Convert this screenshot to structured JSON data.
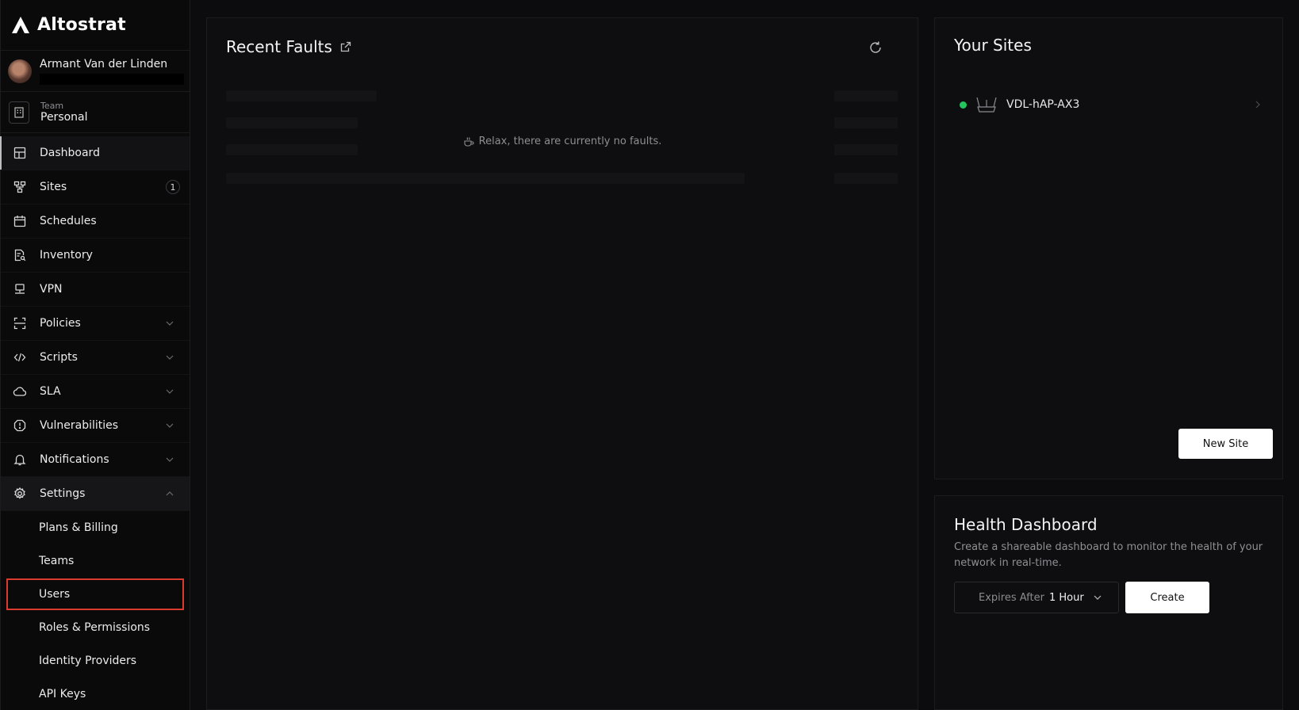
{
  "brand": {
    "name": "Altostrat"
  },
  "user": {
    "name": "Armant Van der Linden"
  },
  "team": {
    "label": "Team",
    "name": "Personal"
  },
  "nav": {
    "dashboard": "Dashboard",
    "sites": "Sites",
    "sites_badge": "1",
    "schedules": "Schedules",
    "inventory": "Inventory",
    "vpn": "VPN",
    "policies": "Policies",
    "scripts": "Scripts",
    "sla": "SLA",
    "vulnerabilities": "Vulnerabilities",
    "notifications": "Notifications",
    "settings": "Settings"
  },
  "settings_sub": {
    "plans": "Plans & Billing",
    "teams": "Teams",
    "users": "Users",
    "roles": "Roles & Permissions",
    "idp": "Identity Providers",
    "api_keys": "API Keys"
  },
  "faults": {
    "title": "Recent Faults",
    "empty_message": "Relax, there are currently no faults."
  },
  "sites_panel": {
    "title": "Your Sites",
    "site_name": "VDL-hAP-AX3",
    "site_status_color": "#22c55e",
    "new_site_label": "New Site"
  },
  "health": {
    "title": "Health Dashboard",
    "description": "Create a shareable dashboard to monitor the health of your network in real-time.",
    "expires_label": "Expires After",
    "expires_value": "1 Hour",
    "create_label": "Create"
  }
}
